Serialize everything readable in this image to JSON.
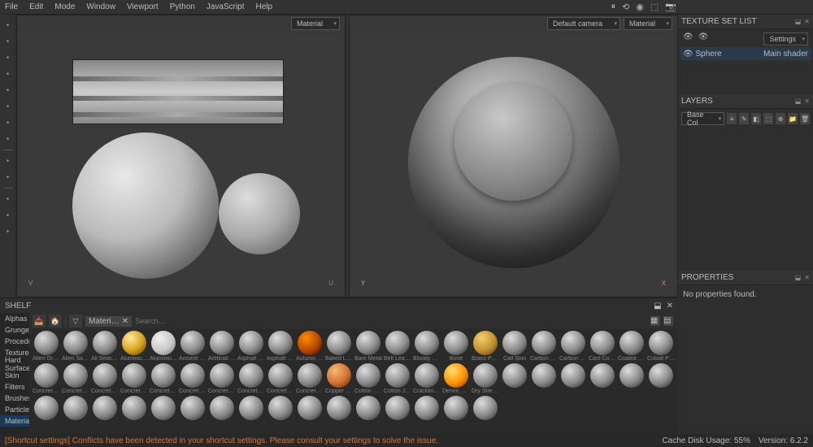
{
  "menu": [
    "File",
    "Edit",
    "Mode",
    "Window",
    "Viewport",
    "Python",
    "JavaScript",
    "Help"
  ],
  "tool_icons": [
    "brush",
    "eraser",
    "projection",
    "polyfill",
    "smudge",
    "clone",
    "material",
    "bake",
    "sep",
    "bucket",
    "dropper",
    "sep",
    "mesh",
    "quick",
    "settings"
  ],
  "top_icons": [
    "pause",
    "orbit",
    "iray",
    "persp",
    "camera"
  ],
  "viewport_left": {
    "dropdown": "Material",
    "axis_v": "V",
    "axis_u": "U"
  },
  "viewport_right": {
    "camera_dd": "Default camera",
    "material_dd": "Material",
    "axis_y": "Y",
    "axis_x": "X"
  },
  "texture_set_list": {
    "title": "TEXTURE SET LIST",
    "settings_label": "Settings",
    "row": {
      "name": "Sphere",
      "shader": "Main shader"
    }
  },
  "layers": {
    "title": "LAYERS",
    "channel_dd": "Base Col",
    "tools": [
      "≡",
      "✎",
      "◧",
      "⬚",
      "⊕",
      "📁",
      "🗑"
    ]
  },
  "properties": {
    "title": "PROPERTIES",
    "empty": "No properties found."
  },
  "shelf": {
    "title": "SHELF",
    "categories": [
      "Alphas",
      "Grunges",
      "Procedurals",
      "Textures",
      "Hard Surfaces",
      "Skin",
      "Filters",
      "Brushes",
      "Particles",
      "Materials"
    ],
    "selected_cat": "Materials",
    "filter_chip": "Materi…",
    "search_placeholder": "Search…",
    "materials_row1": [
      "Alien Grovi…",
      "Alien Sand…",
      "All Season T…",
      "Aluminium…",
      "Aluminium…",
      "Ancient Metal",
      "Artificial Lea…",
      "Asphalt Fin…",
      "Asphalt Fin…",
      "Autumn Leaf",
      "Baked Light…",
      "Bare Metal",
      "Belt Leather",
      "Bloody Batt…",
      "Bone",
      "Brass Pure",
      "Calf Skin",
      "Carbon Fiber",
      "Carbon Fib…",
      "Cast Conc…"
    ],
    "materials_row2": [
      "Coated Metal",
      "Cobalt Pure",
      "Concrete B…",
      "Concrete Cl…",
      "Concrete D…",
      "Concrete La…",
      "Concrete P…",
      "Concrete R…",
      "Concrete R…",
      "Concrete R…",
      "Concrete Si…",
      "Concrete Si…",
      "Copper Pure",
      "Cotton Can…",
      "Cotton Jea…",
      "Crackling Li…",
      "Denim Rivet",
      "Dry Stream…",
      "",
      ""
    ],
    "materials_row3": [
      "",
      "",
      "",
      "",
      "",
      "",
      "",
      "",
      "",
      "",
      "",
      "",
      "",
      "",
      "",
      "",
      "",
      "",
      "",
      ""
    ],
    "ball_colors": {
      "3": "radial-gradient(circle at 35% 30%,#ffe9a0,#d4a017 55%,#4a3000)",
      "4": "radial-gradient(circle at 35% 30%,#f0f0f0,#c8c8c8 55%,#666)",
      "9": "radial-gradient(circle at 35% 30%,#ff8c00,#b04000 60%,#200)",
      "15": "radial-gradient(circle at 35% 30%,#f0d070,#c09030 55%,#503000)",
      "32": "radial-gradient(circle at 35% 30%,#f8b878,#d07030 55%,#502000)",
      "36": "radial-gradient(circle at 35% 30%,#ffe070,#ff9000 55%,#803000)"
    }
  },
  "status": {
    "warning": "[Shortcut settings] Conflicts have been detected in your shortcut settings. Please consult your settings to solve the issue.",
    "cache": "Cache Disk Usage:   55%",
    "version": "Version: 6.2.2"
  }
}
